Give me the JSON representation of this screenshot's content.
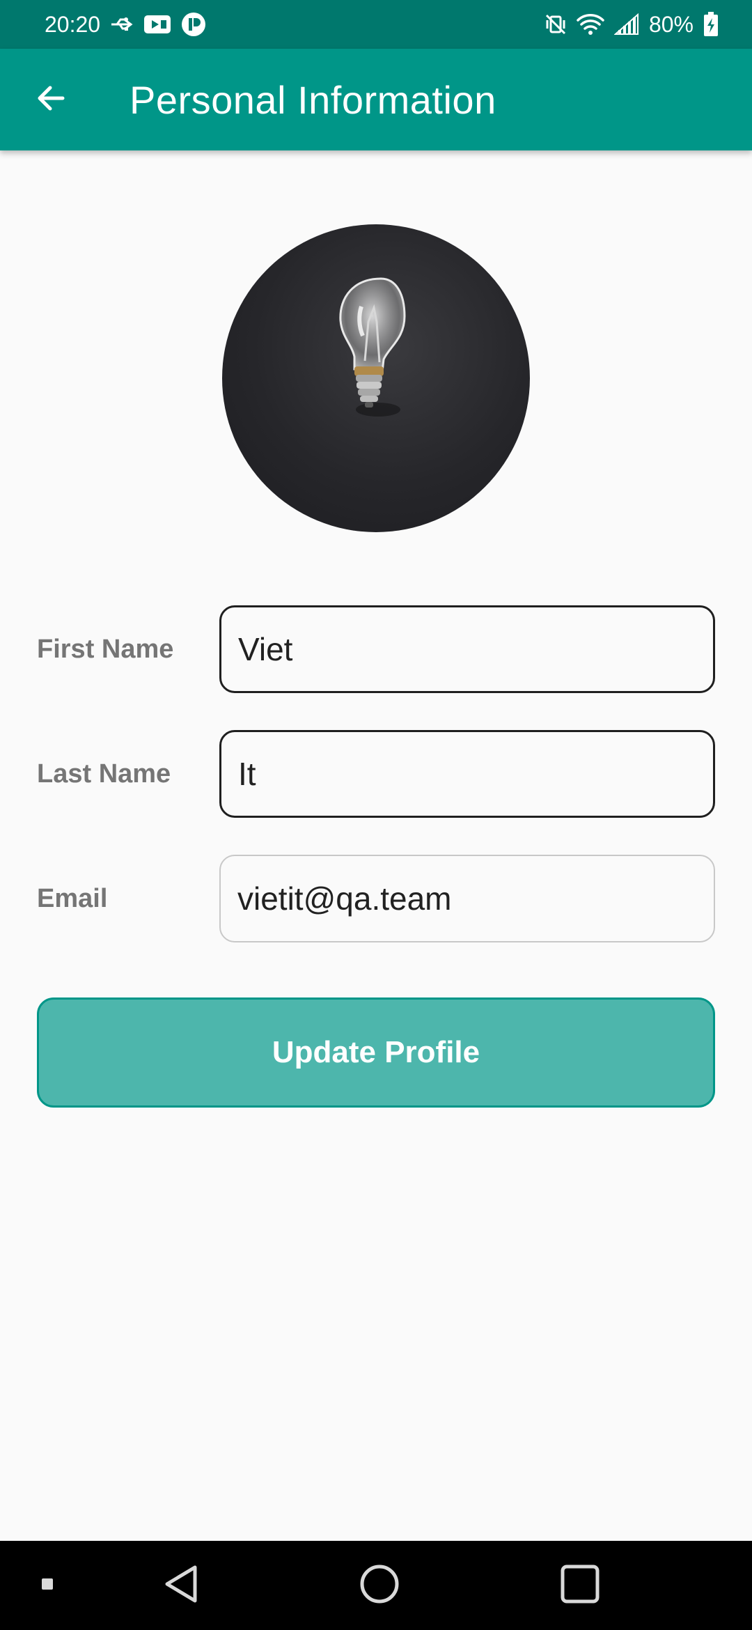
{
  "status_bar": {
    "time": "20:20",
    "battery": "80%",
    "icons_left": [
      "usb-icon",
      "video-camera-icon",
      "record-icon"
    ],
    "icons_right": [
      "mute-vibrate-icon",
      "wifi-icon",
      "signal-icon",
      "battery-charging-icon"
    ]
  },
  "app_bar": {
    "title": "Personal Information",
    "back_icon": "arrow-left-icon",
    "color": "#009688"
  },
  "profile": {
    "avatar_description_icon": "lightbulb-photo"
  },
  "form": {
    "first_name": {
      "label": "First Name",
      "value": "Viet"
    },
    "last_name": {
      "label": "Last Name",
      "value": "It"
    },
    "email": {
      "label": "Email",
      "value": "vietit@qa.team"
    }
  },
  "actions": {
    "update_label": "Update Profile",
    "button_color": "#4db6ac"
  },
  "nav_bar": {
    "icons": [
      "recent-dot-icon",
      "back-triangle-icon",
      "home-circle-icon",
      "overview-square-icon"
    ]
  }
}
